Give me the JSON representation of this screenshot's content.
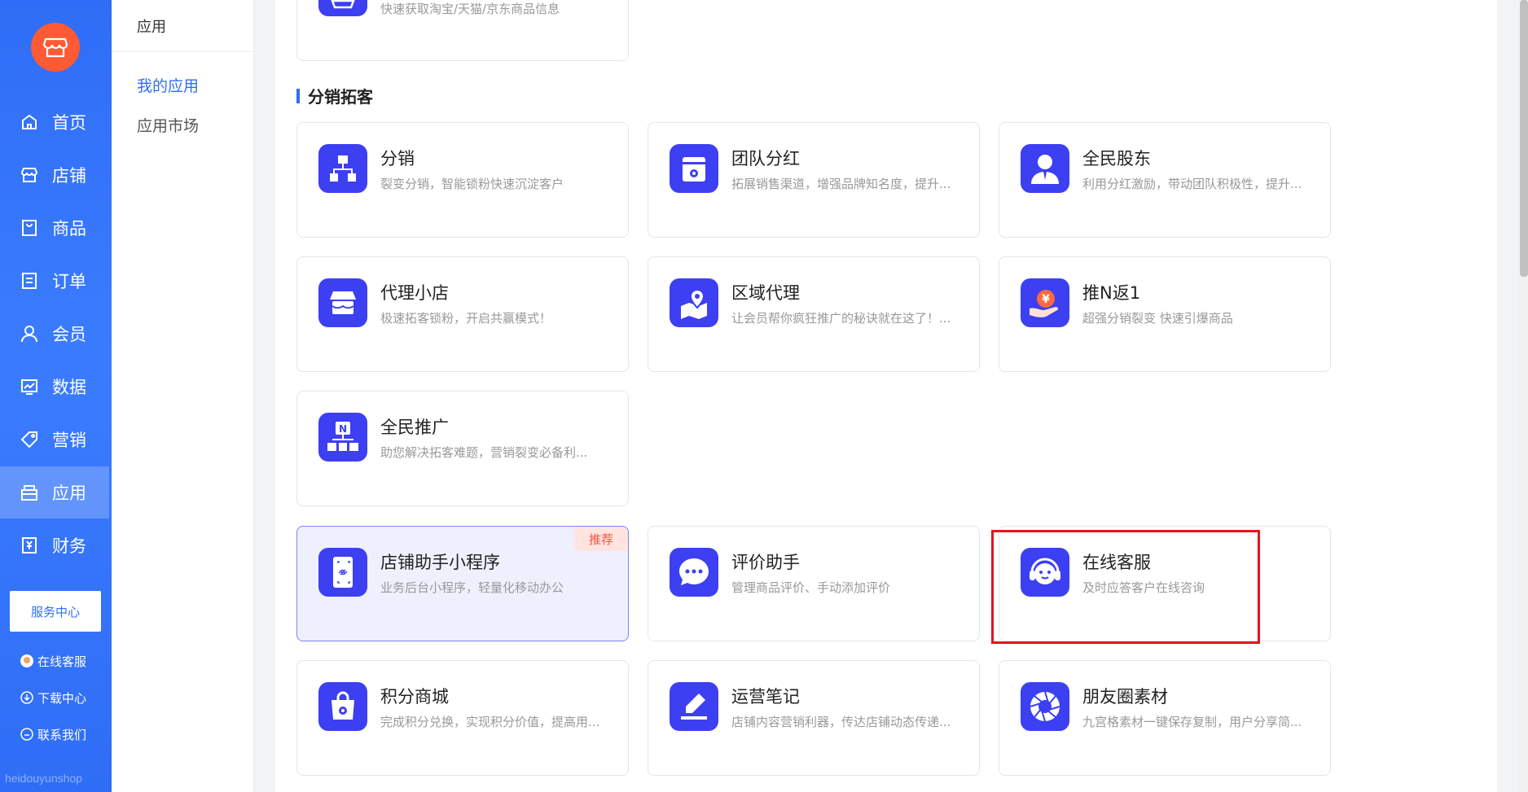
{
  "nav": {
    "items": [
      {
        "label": "首页",
        "icon": "home-icon"
      },
      {
        "label": "店铺",
        "icon": "store-icon"
      },
      {
        "label": "商品",
        "icon": "goods-icon"
      },
      {
        "label": "订单",
        "icon": "order-icon"
      },
      {
        "label": "会员",
        "icon": "member-icon"
      },
      {
        "label": "数据",
        "icon": "data-icon"
      },
      {
        "label": "营销",
        "icon": "tag-icon"
      },
      {
        "label": "应用",
        "icon": "app-icon",
        "active": true
      },
      {
        "label": "财务",
        "icon": "finance-icon"
      }
    ],
    "service_center": "服务中心",
    "links": [
      {
        "label": "在线客服",
        "icon": "avatar-icon"
      },
      {
        "label": "下载中心",
        "icon": "download-icon"
      },
      {
        "label": "联系我们",
        "icon": "chat-icon"
      }
    ],
    "watermark": "heidouyunshop"
  },
  "subnav": {
    "title": "应用",
    "items": [
      "我的应用",
      "应用市场"
    ],
    "active": "我的应用"
  },
  "content": {
    "top_partial_desc": "快速获取淘宝/天猫/京东商品信息",
    "section_title": "分销拓客",
    "cards": [
      {
        "title": "分销",
        "desc": "裂变分销，智能锁粉快速沉淀客户",
        "icon": "org-chart-icon"
      },
      {
        "title": "团队分红",
        "desc": "拓展销售渠道，增强品牌知名度，提升...",
        "icon": "box-icon"
      },
      {
        "title": "全民股东",
        "desc": "利用分红激励，带动团队积极性，提升...",
        "icon": "shareholder-icon"
      },
      {
        "title": "代理小店",
        "desc": "极速拓客锁粉，开启共赢模式！",
        "icon": "shop-icon"
      },
      {
        "title": "区域代理",
        "desc": "让会员帮你疯狂推广的秘诀就在这了！...",
        "icon": "map-pin-icon"
      },
      {
        "title": "推N返1",
        "desc": "超强分销裂变 快速引爆商品",
        "icon": "yen-hand-icon"
      },
      {
        "title": "全民推广",
        "desc": "助您解决拓客难题，营销裂变必备利...",
        "icon": "n-network-icon"
      },
      {
        "title": "店铺助手小程序",
        "desc": "业务后台小程序，轻量化移动办公",
        "icon": "phone-link-icon",
        "badge": "推荐"
      },
      {
        "title": "评价助手",
        "desc": "管理商品评价、手动添加评价",
        "icon": "comment-icon"
      },
      {
        "title": "在线客服",
        "desc": "及时应答客户在线咨询",
        "icon": "support-agent-icon"
      },
      {
        "title": "积分商城",
        "desc": "完成积分兑换，实现积分价值，提高用...",
        "icon": "shopping-bag-icon"
      },
      {
        "title": "运营笔记",
        "desc": "店铺内容营销利器，传达店铺动态传递...",
        "icon": "edit-pen-icon"
      },
      {
        "title": "朋友圈素材",
        "desc": "九宫格素材一键保存复制，用户分享简...",
        "icon": "aperture-icon"
      }
    ]
  },
  "colors": {
    "primary": "#2f6df6",
    "icon_bg": "#3d3ff2",
    "logo": "#ff5a36",
    "highlight_box": "#e8121b"
  }
}
